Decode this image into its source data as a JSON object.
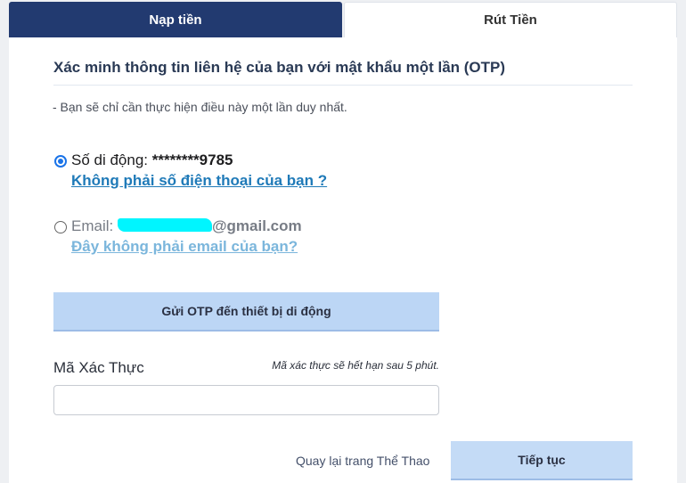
{
  "tabs": {
    "deposit": "Nạp tiền",
    "withdraw": "Rút Tiền"
  },
  "verify": {
    "heading": "Xác minh thông tin liên hệ của bạn với mật khẩu một lần (OTP)",
    "note": "- Bạn sẽ chỉ cần thực hiện điều này một lần duy nhất.",
    "phone": {
      "label": "Số di động: ",
      "value": "********9785",
      "link": "Không phải số điện thoại của bạn ?",
      "selected": true
    },
    "email": {
      "label": "Email: ",
      "value_suffix": "@gmail.com",
      "link": "Đây không phải email của bạn?",
      "selected": false
    },
    "send_otp_button": "Gửi OTP đến thiết bị di động",
    "code_label": "Mã Xác Thực",
    "code_expiry_note": "Mã xác thực sẽ hết hạn sau 5 phút.",
    "code_value": "",
    "back_link": "Quay lại trang Thể Thao",
    "continue_button": "Tiếp tục"
  },
  "colors": {
    "tab_active_bg": "#223a70",
    "link": "#1f7ab8",
    "button_bg": "#bcd6f5",
    "radio_accent": "#1a73e8",
    "redaction": "#00f5ff"
  }
}
